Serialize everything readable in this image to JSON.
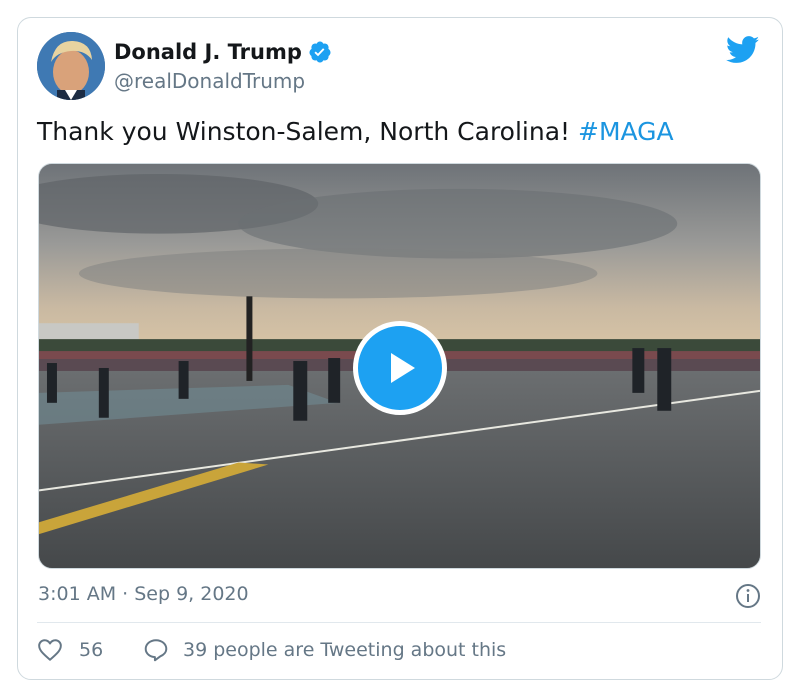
{
  "author": {
    "display_name": "Donald J. Trump",
    "handle": "@realDonaldTrump",
    "verified": true,
    "avatar_icon": "profile-photo"
  },
  "tweet": {
    "text": "Thank you Winston-Salem, North Carolina! ",
    "hashtag": "#MAGA",
    "timestamp": "3:01 AM · Sep 9, 2020"
  },
  "media": {
    "type": "video",
    "play_icon": "play-icon"
  },
  "actions": {
    "like_count": "56",
    "conversation_text": "39 people are Tweeting about this"
  },
  "colors": {
    "accent": "#1da1f2",
    "hashtag": "#1b95e0",
    "secondary_text": "#657786",
    "border": "#cfd9de"
  }
}
